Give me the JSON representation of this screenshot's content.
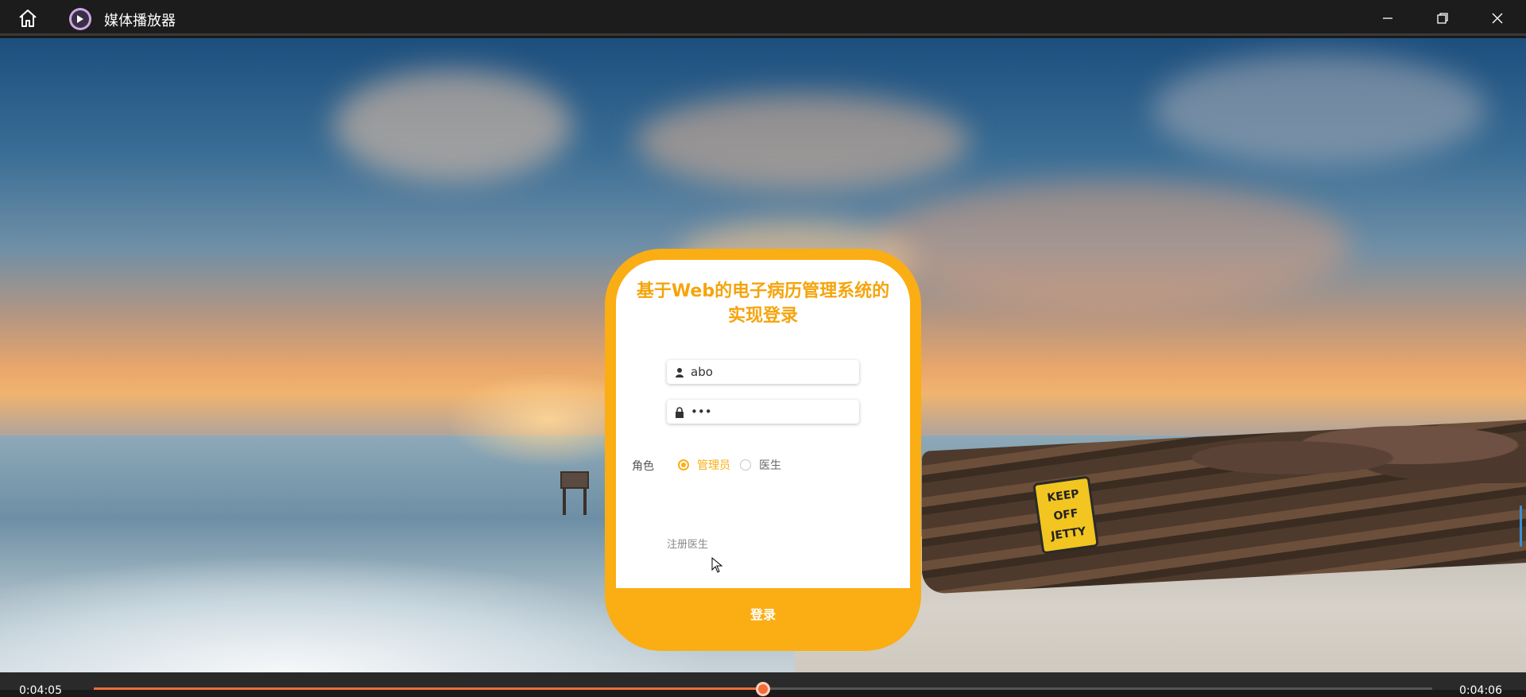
{
  "app": {
    "title": "媒体播放器",
    "icons": [
      "home-icon",
      "media-player-logo-icon",
      "minimize-icon",
      "restore-icon",
      "close-icon"
    ]
  },
  "login": {
    "title_line1": "基于Web的电子病历管理系统的",
    "title_line2": "实现登录",
    "username_value": "abo",
    "password_value": "•••",
    "role_label": "角色",
    "roles": [
      "管理员",
      "医生"
    ],
    "selected_role": "管理员",
    "register_link": "注册医生",
    "login_button": "登录",
    "accent": "#fbad14"
  },
  "player": {
    "current_time": "0:04:05",
    "total_time": "0:04:06",
    "progress": 0.5,
    "progress_color": "#f26b3a"
  },
  "scene": {
    "sign_text": "KEEP OFF JETTY"
  }
}
